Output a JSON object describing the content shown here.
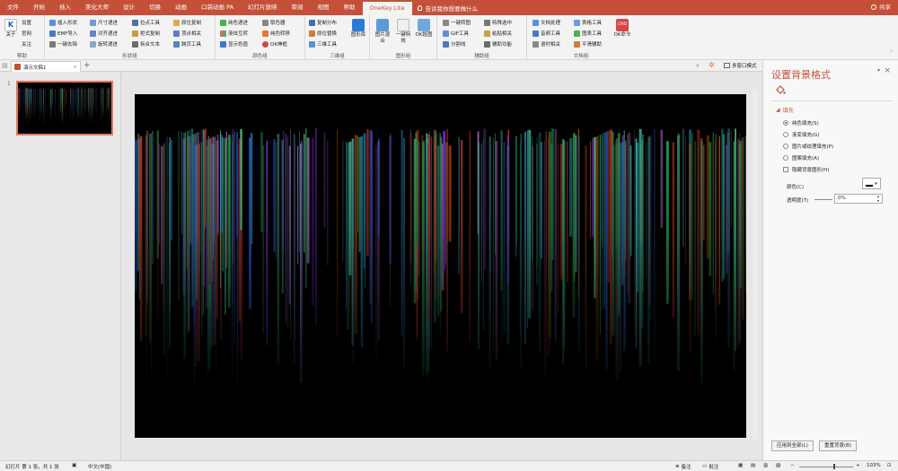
{
  "menu": {
    "items": [
      "文件",
      "开始",
      "插入",
      "美化大师",
      "设计",
      "切换",
      "动画",
      "口袋动画 PA",
      "幻灯片放映",
      "审阅",
      "视图",
      "帮助"
    ],
    "active_tab": "OneKey Lite",
    "tellme": "告诉我你想要做什么",
    "share": "共享"
  },
  "ribbon": {
    "help": {
      "about": "关于",
      "settings": "设置",
      "website": "官网",
      "follow": "关注",
      "label": "帮助"
    },
    "shape": {
      "insert_shape": "插入形状",
      "emf_import": "EMF导入",
      "one_click_remove": "一键去除",
      "size_increment": "尺寸递进",
      "align_increment": "对齐递进",
      "rotate_increment": "旋转递进",
      "anchor_tool": "拉点工具",
      "copy_format": "拒式复制",
      "split_text": "拆合文本",
      "in_place_copy": "原位复制",
      "vertex_related": "顶点相关",
      "cross_page_tool": "跨页工具",
      "label": "形状组"
    },
    "color": {
      "solid_increment": "纯色递进",
      "gradient_swap": "渐炫互转",
      "show_palette": "显示色值",
      "color_picker": "取色器",
      "solid_transform": "纯色转移",
      "ok_magic": "OK神框",
      "label": "颜色组"
    },
    "threed": {
      "copy_distribute": "复制分布",
      "rotate_copy": "原位替换",
      "threed_tool": "三维工具",
      "shape_lib": "图形库",
      "label": "三维组"
    },
    "image": {
      "image_mix": "图片混合",
      "one_click_effect": "一键特效",
      "ok_cutout": "OK抠图",
      "label": "图形组"
    },
    "assist": {
      "one_click_convert": "一键转图",
      "gif_tool": "GIF工具",
      "split_line": "分割线",
      "select_special": "特殊选中",
      "paste_related": "粘贴相关",
      "assist_func": "辅助功能",
      "label": "辅助组"
    },
    "document": {
      "doc_process": "文档处理",
      "audio_tool": "音频工具",
      "rebuild_related": "退村相关",
      "table_tool": "表格工具",
      "chart_tool": "图表工具",
      "smooth_assist": "平滑辅助",
      "cmd": "CMD",
      "ok_cmd": "OK命令",
      "label": "文档组"
    }
  },
  "tabstrip": {
    "doc_name": "演示文稿1",
    "view_mode": "多窗口模式"
  },
  "thumbnails": {
    "slide_number": "1"
  },
  "format_pane": {
    "title": "设置背景格式",
    "section": "填充",
    "options": [
      {
        "label": "纯色填充(S)",
        "selected": true
      },
      {
        "label": "渐变填充(G)",
        "selected": false
      },
      {
        "label": "图片或纹理填充(P)",
        "selected": false
      },
      {
        "label": "图案填充(A)",
        "selected": false
      }
    ],
    "hide_graphics": "隐藏背景图形(H)",
    "color_label": "颜色(C)",
    "transparency_label": "透明度(T)",
    "transparency_value": "0%",
    "apply_all": "应用到全部(L)",
    "reset_bg": "重置背景(B)"
  },
  "status": {
    "slide_info": "幻灯片 第 1 张，共 1 张",
    "language": "中文(中国)",
    "notes": "备注",
    "comments": "批注",
    "zoom": "103%"
  },
  "colors": {
    "accent": "#c55039",
    "ribbon_bg": "#f3f3f3",
    "slide_bg": "#000000"
  }
}
